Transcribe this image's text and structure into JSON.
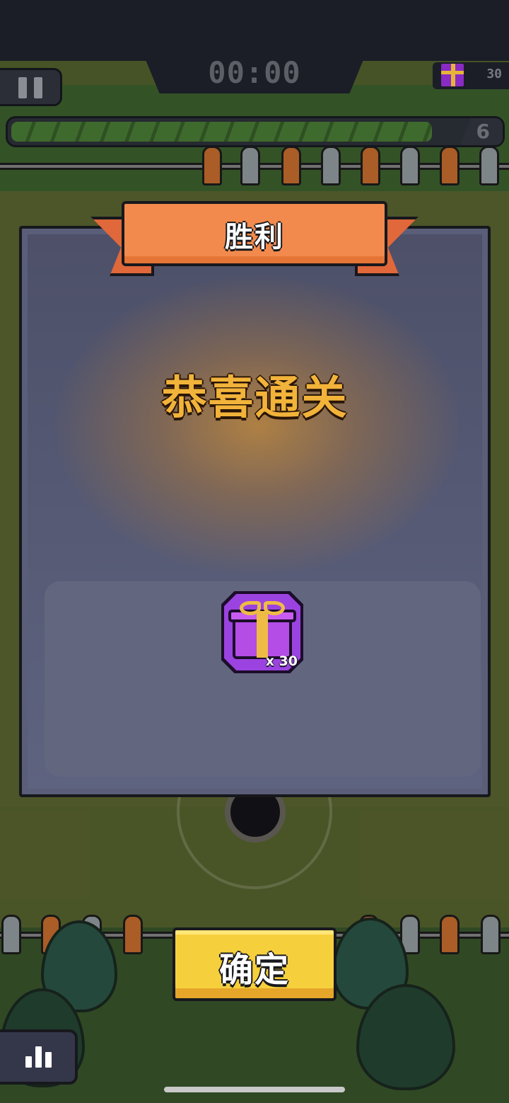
{
  "hud": {
    "timer": "00:00",
    "gift_count": "30",
    "level": "6",
    "progress_fraction": 0.93
  },
  "dialog": {
    "banner_title": "胜利",
    "congrats_text": "恭喜通关",
    "reward": {
      "icon": "gift-box-icon",
      "quantity": "x 30"
    }
  },
  "buttons": {
    "confirm": "确定",
    "stats": "bar-chart-icon"
  },
  "colors": {
    "banner": "#f28a4d",
    "congrats": "#f2b33a",
    "confirm": "#f6cf3d",
    "gift": "#9b43e0"
  }
}
